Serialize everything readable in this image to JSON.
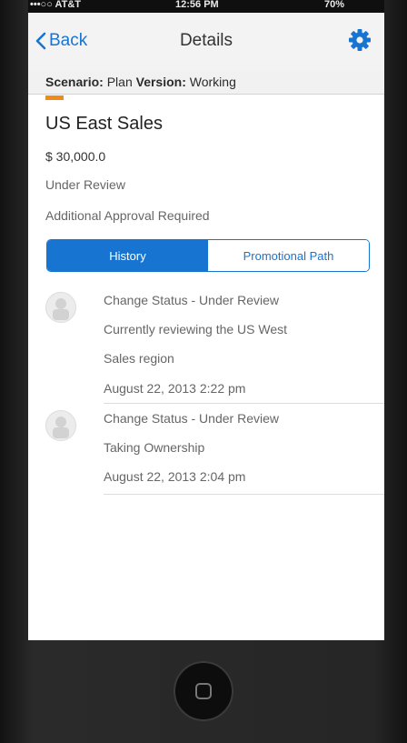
{
  "status_bar": {
    "carrier": "•••○○ AT&T",
    "time": "12:56 PM",
    "battery": "70%"
  },
  "nav": {
    "back_label": "Back",
    "title": "Details",
    "settings_icon": "gear-icon"
  },
  "scenario_bar": {
    "scenario_label": "Scenario:",
    "scenario_value": "Plan",
    "version_label": "Version:",
    "version_value": "Working"
  },
  "detail": {
    "accent_color": "#ee8b1a",
    "title": "US East Sales",
    "amount": "$ 30,000.0",
    "status": "Under Review",
    "approval": "Additional Approval Required"
  },
  "tabs": [
    {
      "label": "History",
      "selected": true
    },
    {
      "label": "Promotional Path",
      "selected": false
    }
  ],
  "history": [
    {
      "action": "Change Status - Under Review",
      "comment_lines": [
        "Currently reviewing the US West",
        "Sales region"
      ],
      "timestamp": "August 22, 2013 2:22 pm"
    },
    {
      "action": "Change Status - Under Review",
      "comment_lines": [
        "Taking Ownership"
      ],
      "timestamp": "August 22, 2013 2:04 pm"
    }
  ],
  "colors": {
    "accent_blue": "#1874d1",
    "status_orange": "#ee8b1a"
  }
}
